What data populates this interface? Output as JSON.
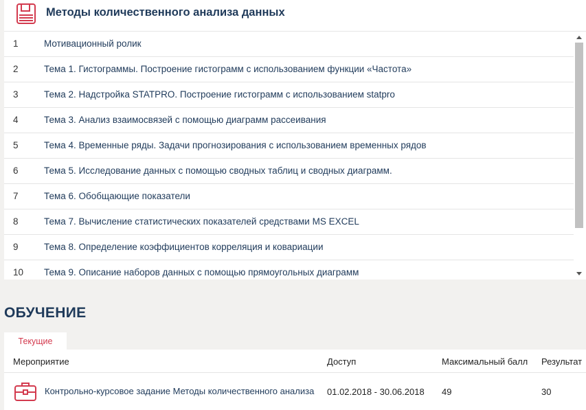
{
  "course": {
    "title": "Методы количественного анализа данных",
    "icon": "book-icon",
    "accent_color": "#d33a4e",
    "lessons": [
      {
        "num": "1",
        "title": "Мотивационный ролик"
      },
      {
        "num": "2",
        "title": "Тема 1. Гистограммы. Построение гистограмм с использованием функции «Частота»"
      },
      {
        "num": "3",
        "title": "Тема 2. Надстройка STATPRO. Построение гистограмм с использованием statpro"
      },
      {
        "num": "4",
        "title": "Тема 3. Анализ взаимосвязей с помощью диаграмм рассеивания"
      },
      {
        "num": "5",
        "title": "Тема 4. Временные ряды. Задачи прогнозирования с использованием временных рядов"
      },
      {
        "num": "6",
        "title": "Тема 5. Исследование данных с помощью сводных таблиц и сводных диаграмм."
      },
      {
        "num": "7",
        "title": "Тема 6. Обобщающие показатели"
      },
      {
        "num": "8",
        "title": "Тема 7. Вычисление статистических показателей средствами MS EXCEL"
      },
      {
        "num": "9",
        "title": "Тема 8. Определение коэффициентов корреляция и ковариации"
      },
      {
        "num": "10",
        "title": "Тема 9. Описание наборов данных с помощью прямоугольных диаграмм"
      }
    ]
  },
  "learning": {
    "section_title": "ОБУЧЕНИЕ",
    "tab_current": "Текущие",
    "columns": {
      "event": "Мероприятие",
      "access": "Доступ",
      "max_score": "Максимальный балл",
      "result": "Результат"
    },
    "rows": [
      {
        "icon": "briefcase-icon",
        "event": "Контрольно-курсовое задание Методы количественного анализа",
        "access": "01.02.2018 - 30.06.2018",
        "max_score": "49",
        "result": "30"
      }
    ]
  }
}
